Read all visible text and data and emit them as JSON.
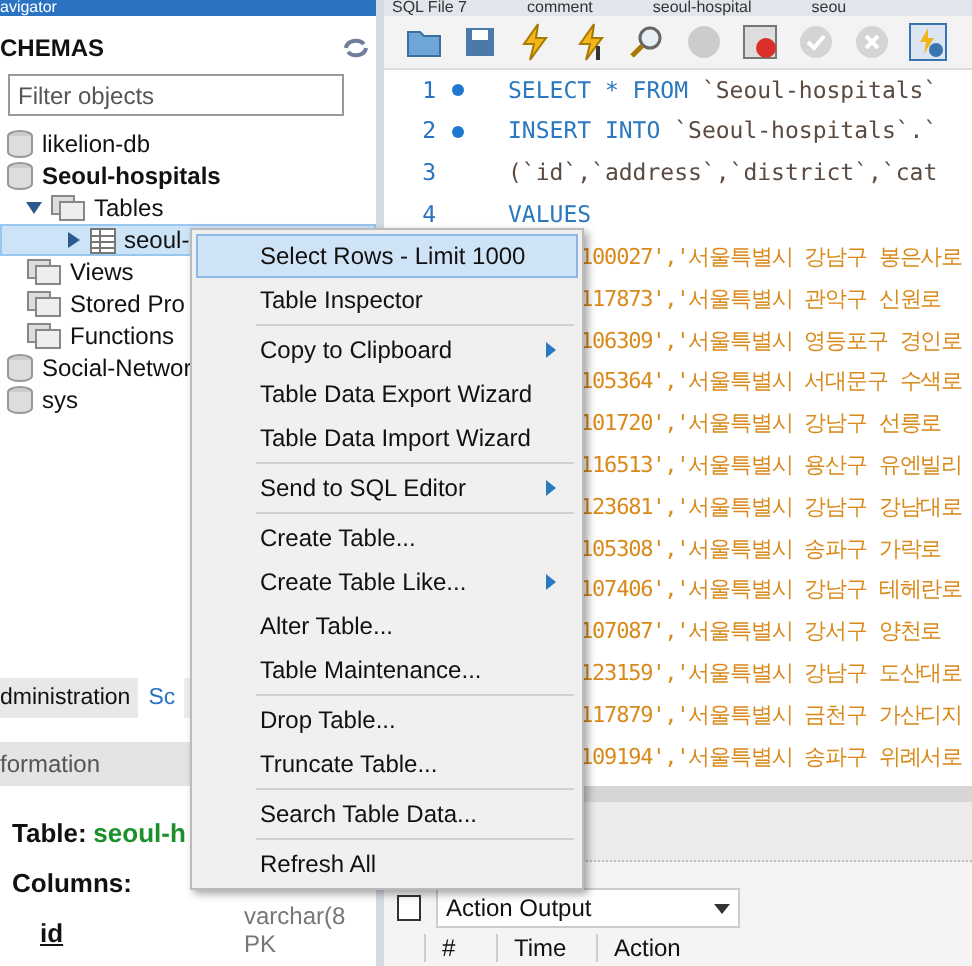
{
  "navigator": {
    "title": "avigator",
    "section": "CHEMAS",
    "filter": {
      "placeholder": "Filter objects"
    },
    "tree": [
      {
        "label": "likelion-db",
        "bold": false,
        "selected": false,
        "kind": "schema"
      },
      {
        "label": "Seoul-hospitals",
        "bold": true,
        "selected": false,
        "kind": "schema",
        "children": [
          {
            "label": "Tables",
            "bold": false,
            "selected": false,
            "kind": "folder",
            "expanded": true,
            "children": [
              {
                "label": "seoul-",
                "bold": false,
                "selected": true,
                "kind": "table",
                "expanded": false
              }
            ]
          },
          {
            "label": "Views",
            "bold": false,
            "selected": false,
            "kind": "folder"
          },
          {
            "label": "Stored Pro",
            "bold": false,
            "selected": false,
            "kind": "folder"
          },
          {
            "label": "Functions",
            "bold": false,
            "selected": false,
            "kind": "folder"
          }
        ]
      },
      {
        "label": "Social-Networ",
        "bold": false,
        "selected": false,
        "kind": "schema"
      },
      {
        "label": "sys",
        "bold": false,
        "selected": false,
        "kind": "schema"
      }
    ]
  },
  "lower_tabs": [
    {
      "label": "dministration",
      "selected": false
    },
    {
      "label": "Sc",
      "selected": true
    }
  ],
  "info": {
    "title": "formation",
    "table_label": "Table:",
    "table_name": "seoul-h",
    "columns_label": "Columns:",
    "column": "id",
    "type": "varchar(8",
    "key": "PK"
  },
  "editor_tabs": [
    {
      "label": "SQL File 7",
      "selected": false
    },
    {
      "label": "comment",
      "selected": false
    },
    {
      "label": "seoul-hospital",
      "selected": false
    },
    {
      "label": "seou",
      "selected": false
    }
  ],
  "toolbar": [
    {
      "kind": "folder"
    },
    {
      "kind": "save"
    },
    {
      "kind": "bolt"
    },
    {
      "kind": "bolt-cursor"
    },
    {
      "kind": "explain"
    },
    {
      "kind": "stop"
    },
    {
      "kind": "error-toggle"
    },
    {
      "kind": "commit"
    },
    {
      "kind": "rollback"
    },
    {
      "kind": "autocommit"
    }
  ],
  "code": [
    {
      "number": "1",
      "marked": true,
      "tokens": [
        {
          "kind": "keyword",
          "text": "SELECT * FROM "
        },
        {
          "kind": "ident",
          "text": "`Seoul-hospitals`"
        }
      ]
    },
    {
      "number": "2",
      "marked": true,
      "tokens": [
        {
          "kind": "keyword",
          "text": "INSERT INTO "
        },
        {
          "kind": "ident",
          "text": "`Seoul-hospitals`.`"
        }
      ]
    },
    {
      "number": "3",
      "tokens": [
        {
          "kind": "ident",
          "text": "(`id`,`address`,`district`,`cat"
        }
      ]
    },
    {
      "number": "4",
      "tokens": [
        {
          "kind": "keyword",
          "text": "VALUES"
        }
      ]
    }
  ],
  "value_rows": [
    "100027','서울특별시 강남구 봉은사로",
    "117873','서울특별시 관악구 신원로",
    "106309','서울특별시 영등포구 경인로",
    "105364','서울특별시 서대문구 수색로",
    "101720','서울특별시 강남구 선릉로",
    "116513','서울특별시 용산구 유엔빌리",
    "123681','서울특별시 강남구 강남대로",
    "105308','서울특별시 송파구 가락로",
    "107406','서울특별시 강남구 테헤란로",
    "107087','서울특별시 강서구 양천로",
    "123159','서울특별시 강남구 도산대로",
    "117879','서울특별시 금천구 가산디지",
    "109194','서울특별시 송파구 위례서로"
  ],
  "output": {
    "selector": "Action Output",
    "columns": [
      "#",
      "Time",
      "Action"
    ]
  },
  "context_menu": [
    {
      "kind": "item",
      "label": "Select Rows - Limit 1000",
      "selected": true,
      "submenu": false
    },
    {
      "kind": "item",
      "label": "Table Inspector",
      "selected": false,
      "submenu": false
    },
    {
      "kind": "separator"
    },
    {
      "kind": "item",
      "label": "Copy to Clipboard",
      "selected": false,
      "submenu": true
    },
    {
      "kind": "item",
      "label": "Table Data Export Wizard",
      "selected": false,
      "submenu": false
    },
    {
      "kind": "item",
      "label": "Table Data Import Wizard",
      "selected": false,
      "submenu": false
    },
    {
      "kind": "separator"
    },
    {
      "kind": "item",
      "label": "Send to SQL Editor",
      "selected": false,
      "submenu": true
    },
    {
      "kind": "separator"
    },
    {
      "kind": "item",
      "label": "Create Table...",
      "selected": false,
      "submenu": false
    },
    {
      "kind": "item",
      "label": "Create Table Like...",
      "selected": false,
      "submenu": true
    },
    {
      "kind": "item",
      "label": "Alter Table...",
      "selected": false,
      "submenu": false
    },
    {
      "kind": "item",
      "label": "Table Maintenance...",
      "selected": false,
      "submenu": false
    },
    {
      "kind": "separator"
    },
    {
      "kind": "item",
      "label": "Drop Table...",
      "selected": false,
      "submenu": false
    },
    {
      "kind": "item",
      "label": "Truncate Table...",
      "selected": false,
      "submenu": false
    },
    {
      "kind": "separator"
    },
    {
      "kind": "item",
      "label": "Search Table Data...",
      "selected": false,
      "submenu": false
    },
    {
      "kind": "separator"
    },
    {
      "kind": "item",
      "label": "Refresh All",
      "selected": false,
      "submenu": false
    }
  ]
}
